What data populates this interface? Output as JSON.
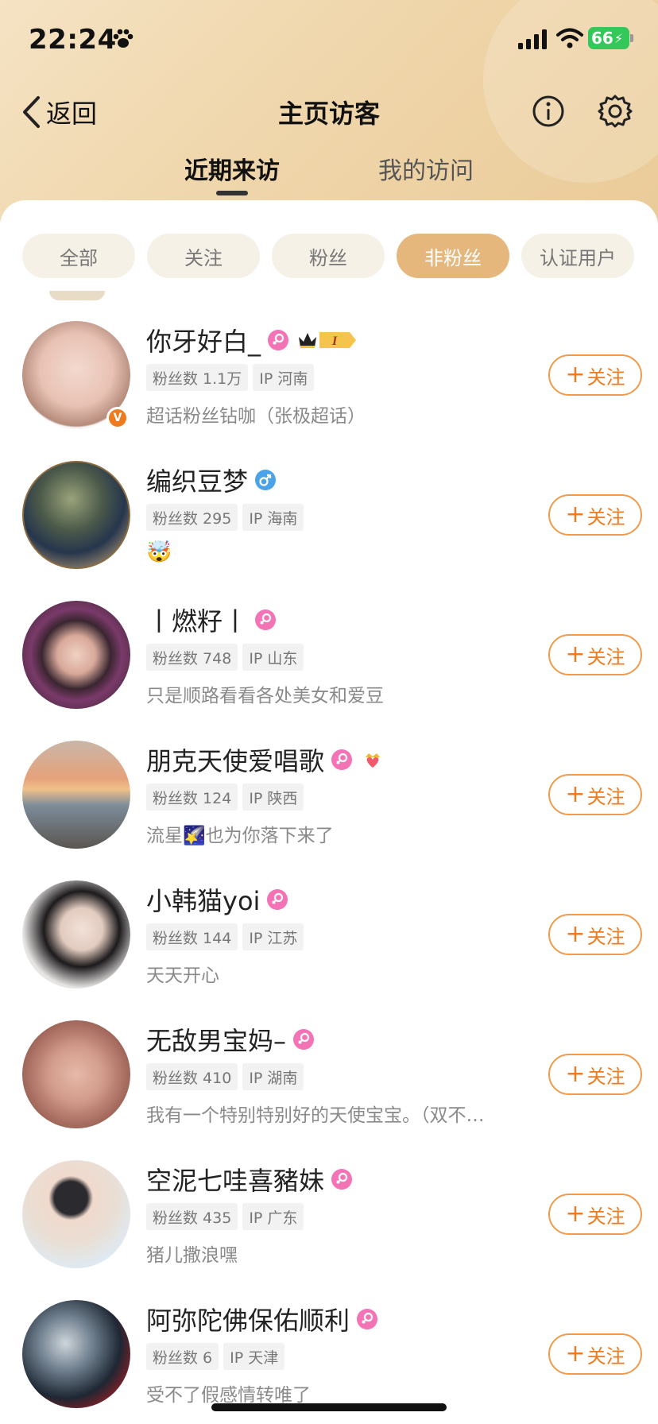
{
  "status_bar": {
    "time": "22:24",
    "battery": "66"
  },
  "header": {
    "back_label": "返回",
    "title": "主页访客"
  },
  "tabs": [
    {
      "label": "近期来访",
      "active": true
    },
    {
      "label": "我的访问",
      "active": false
    }
  ],
  "filters": [
    {
      "label": "全部",
      "active": false
    },
    {
      "label": "关注",
      "active": false
    },
    {
      "label": "粉丝",
      "active": false
    },
    {
      "label": "非粉丝",
      "active": true
    },
    {
      "label": "认证用户",
      "active": false
    }
  ],
  "follow_label": "关注",
  "colors": {
    "accent": "#f07b1e",
    "chip_active": "#e6b77c",
    "female": "#f472b6",
    "male": "#4aa3e8"
  },
  "visitors": [
    {
      "name": "你牙好白_",
      "gender": "female",
      "fans": "粉丝数 1.1万",
      "ip": "IP 河南",
      "bio": "超话粉丝钻咖（张极超话）",
      "verified_badge": "V",
      "level_badge": "I"
    },
    {
      "name": "编织豆梦",
      "gender": "male",
      "fans": "粉丝数 295",
      "ip": "IP 海南",
      "bio": "🤯"
    },
    {
      "name": "丨燃籽丨",
      "gender": "female",
      "fans": "粉丝数 748",
      "ip": "IP 山东",
      "bio": "只是顺路看看各处美女和爱豆"
    },
    {
      "name": "朋克天使爱唱歌",
      "gender": "female",
      "fans": "粉丝数 124",
      "ip": "IP 陕西",
      "bio": "流星🌠也为你落下来了",
      "extra_badge": "crown-heart"
    },
    {
      "name": "小韩猫yoi",
      "gender": "female",
      "fans": "粉丝数 144",
      "ip": "IP 江苏",
      "bio": "天天开心"
    },
    {
      "name": "无敌男宝妈–",
      "gender": "female",
      "fans": "粉丝数 410",
      "ip": "IP 湖南",
      "bio": "我有一个特别特别好的天使宝宝。（双不…"
    },
    {
      "name": "空泥七哇喜豬妹",
      "gender": "female",
      "fans": "粉丝数 435",
      "ip": "IP 广东",
      "bio": "猪儿撒浪嘿"
    },
    {
      "name": "阿弥陀佛保佑顺利",
      "gender": "female",
      "fans": "粉丝数 6",
      "ip": "IP 天津",
      "bio": "受不了假感情转唯了"
    }
  ]
}
